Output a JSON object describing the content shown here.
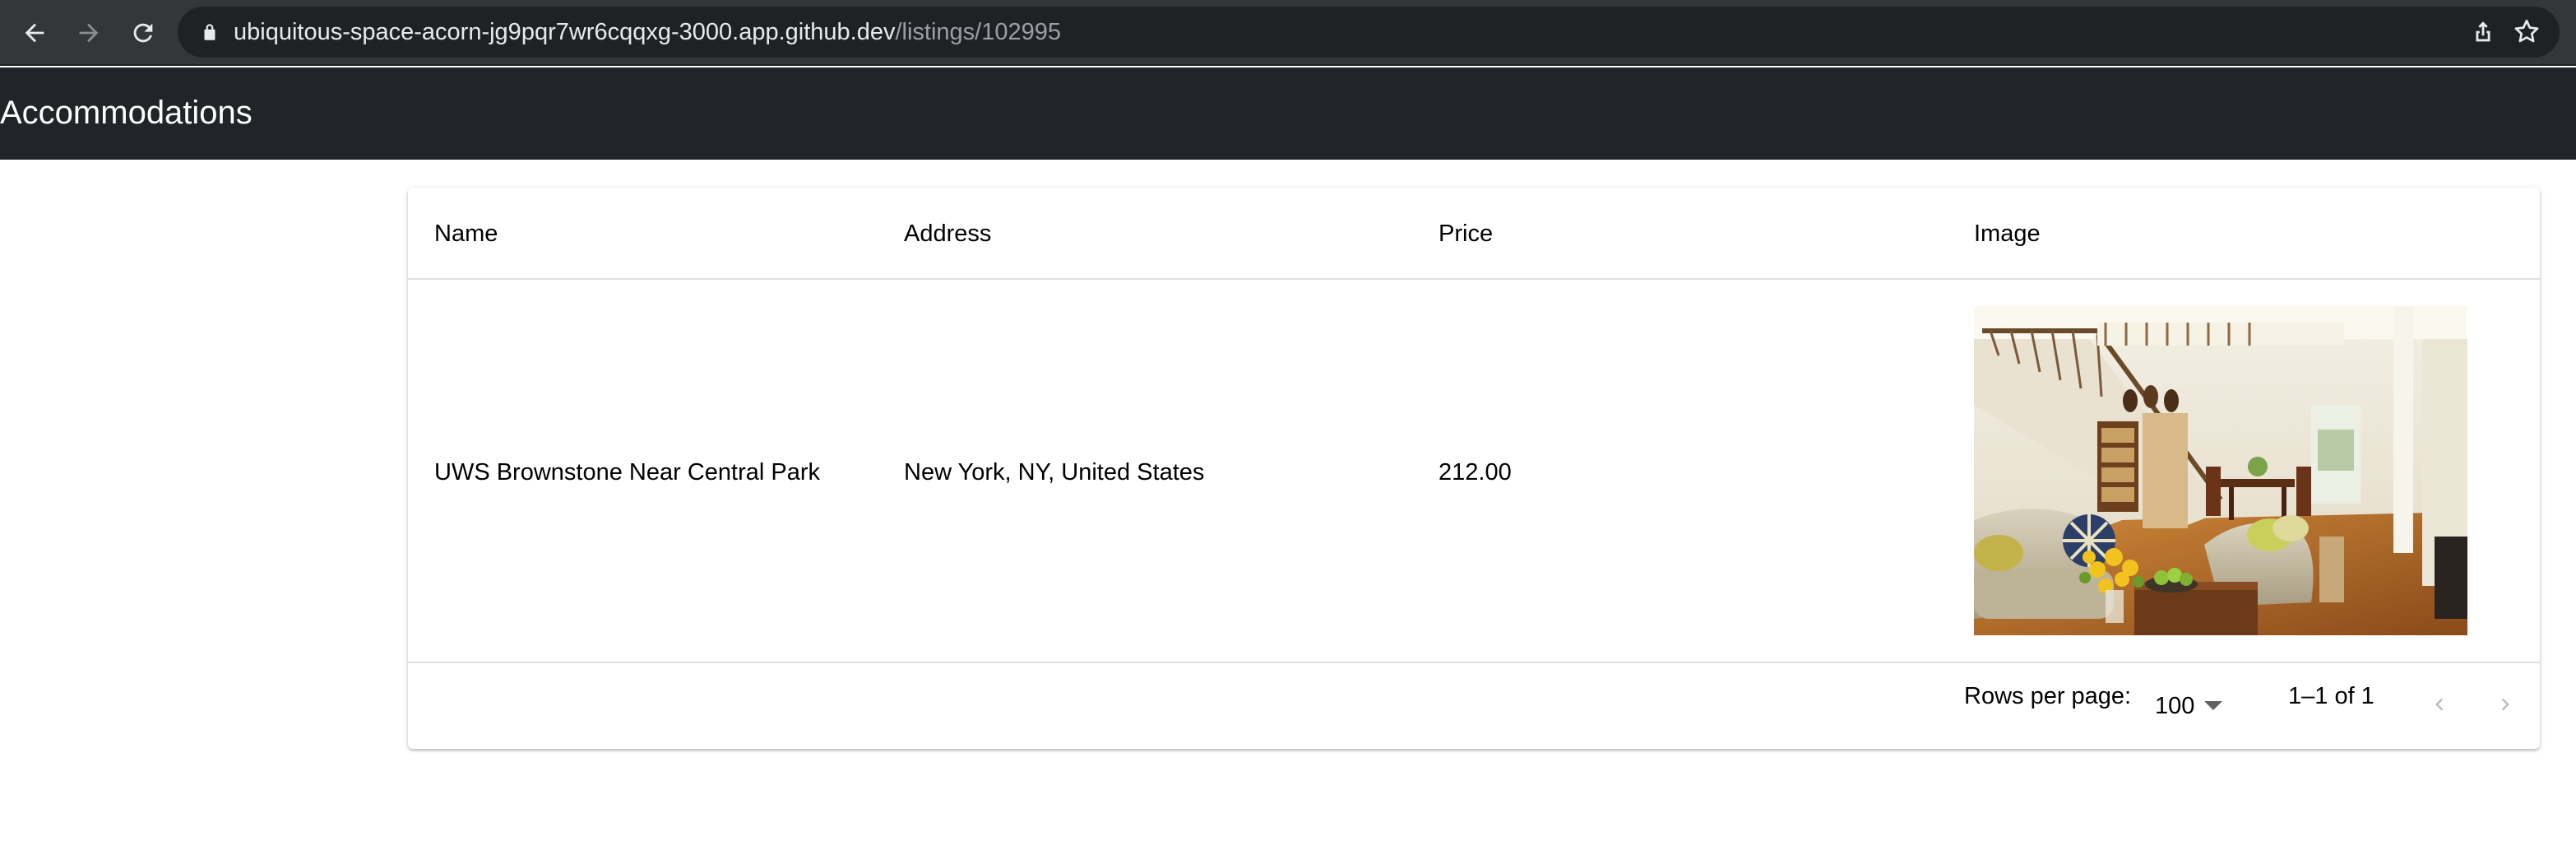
{
  "browser": {
    "url_host": "ubiquitous-space-acorn-jg9pqr7wr6cqqxg-3000.app.github.dev",
    "url_path": "/listings/102995",
    "icons": [
      "back-arrow-icon",
      "forward-arrow-icon",
      "reload-icon",
      "lock-icon",
      "share-icon",
      "star-icon"
    ]
  },
  "app": {
    "title": "Accommodations",
    "header_color": "#212529"
  },
  "table": {
    "columns": [
      "Name",
      "Address",
      "Price",
      "Image"
    ],
    "rows": [
      {
        "name": "UWS Brownstone Near Central Park",
        "address": "New York, NY, United States",
        "price": "212.00",
        "image_alt": "living room photo"
      }
    ]
  },
  "pagination": {
    "rows_per_page_label": "Rows per page:",
    "rows_per_page_value": "100",
    "range_label": "1–1 of 1",
    "icons": [
      "chevron-left-icon",
      "chevron-right-icon"
    ]
  }
}
